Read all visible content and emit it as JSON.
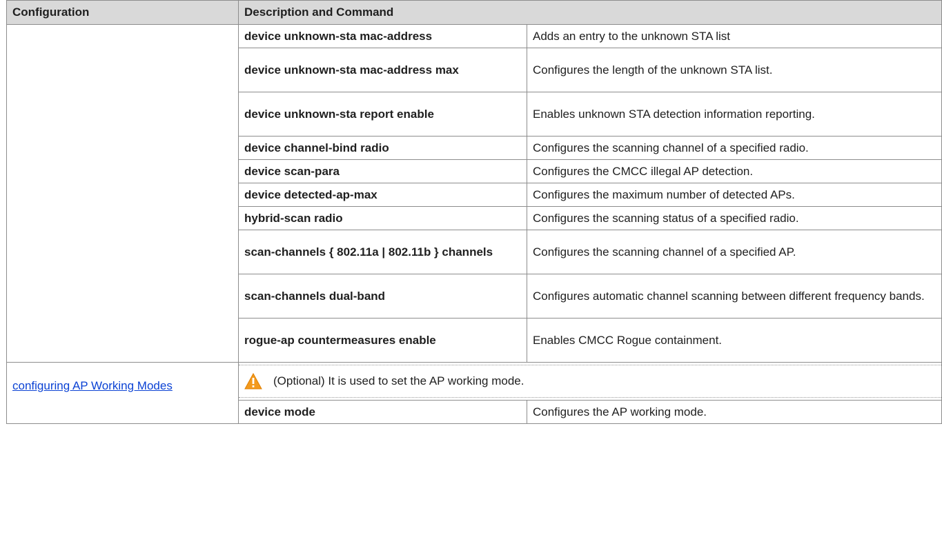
{
  "table": {
    "headers": {
      "configuration": "Configuration",
      "description": "Description and Command"
    },
    "rows": [
      {
        "command": "device unknown-sta mac-address",
        "description": "Adds an entry to the unknown STA list"
      },
      {
        "command": "device unknown-sta mac-address max",
        "description": "Configures the length of the unknown STA list."
      },
      {
        "command": "device unknown-sta report enable",
        "description": "Enables unknown STA detection information reporting."
      },
      {
        "command": "device channel-bind radio",
        "description": "Configures the scanning channel of a specified radio."
      },
      {
        "command": "device scan-para",
        "description": "Configures the CMCC illegal AP detection."
      },
      {
        "command": "device detected-ap-max",
        "description": "Configures the maximum number of detected APs."
      },
      {
        "command": "hybrid-scan radio",
        "description": "Configures the scanning status of a specified radio."
      },
      {
        "command": "scan-channels { 802.11a | 802.11b } channels",
        "description": "Configures the scanning channel of a specified AP."
      },
      {
        "command": "scan-channels dual-band",
        "description": "Configures automatic channel scanning between different frequency bands."
      },
      {
        "command": "rogue-ap countermeasures enable",
        "description": "Enables CMCC Rogue containment."
      }
    ],
    "section2": {
      "link_label": "configuring AP Working Modes",
      "note": "(Optional) It is used to set the AP working mode.",
      "row": {
        "command": "device mode",
        "description": "Configures the AP working mode."
      }
    }
  },
  "icons": {
    "note_icon": "warning-icon"
  },
  "colors": {
    "header_bg": "#d9d9d9",
    "link": "#0b42d4",
    "warning": "#f39a1e"
  }
}
